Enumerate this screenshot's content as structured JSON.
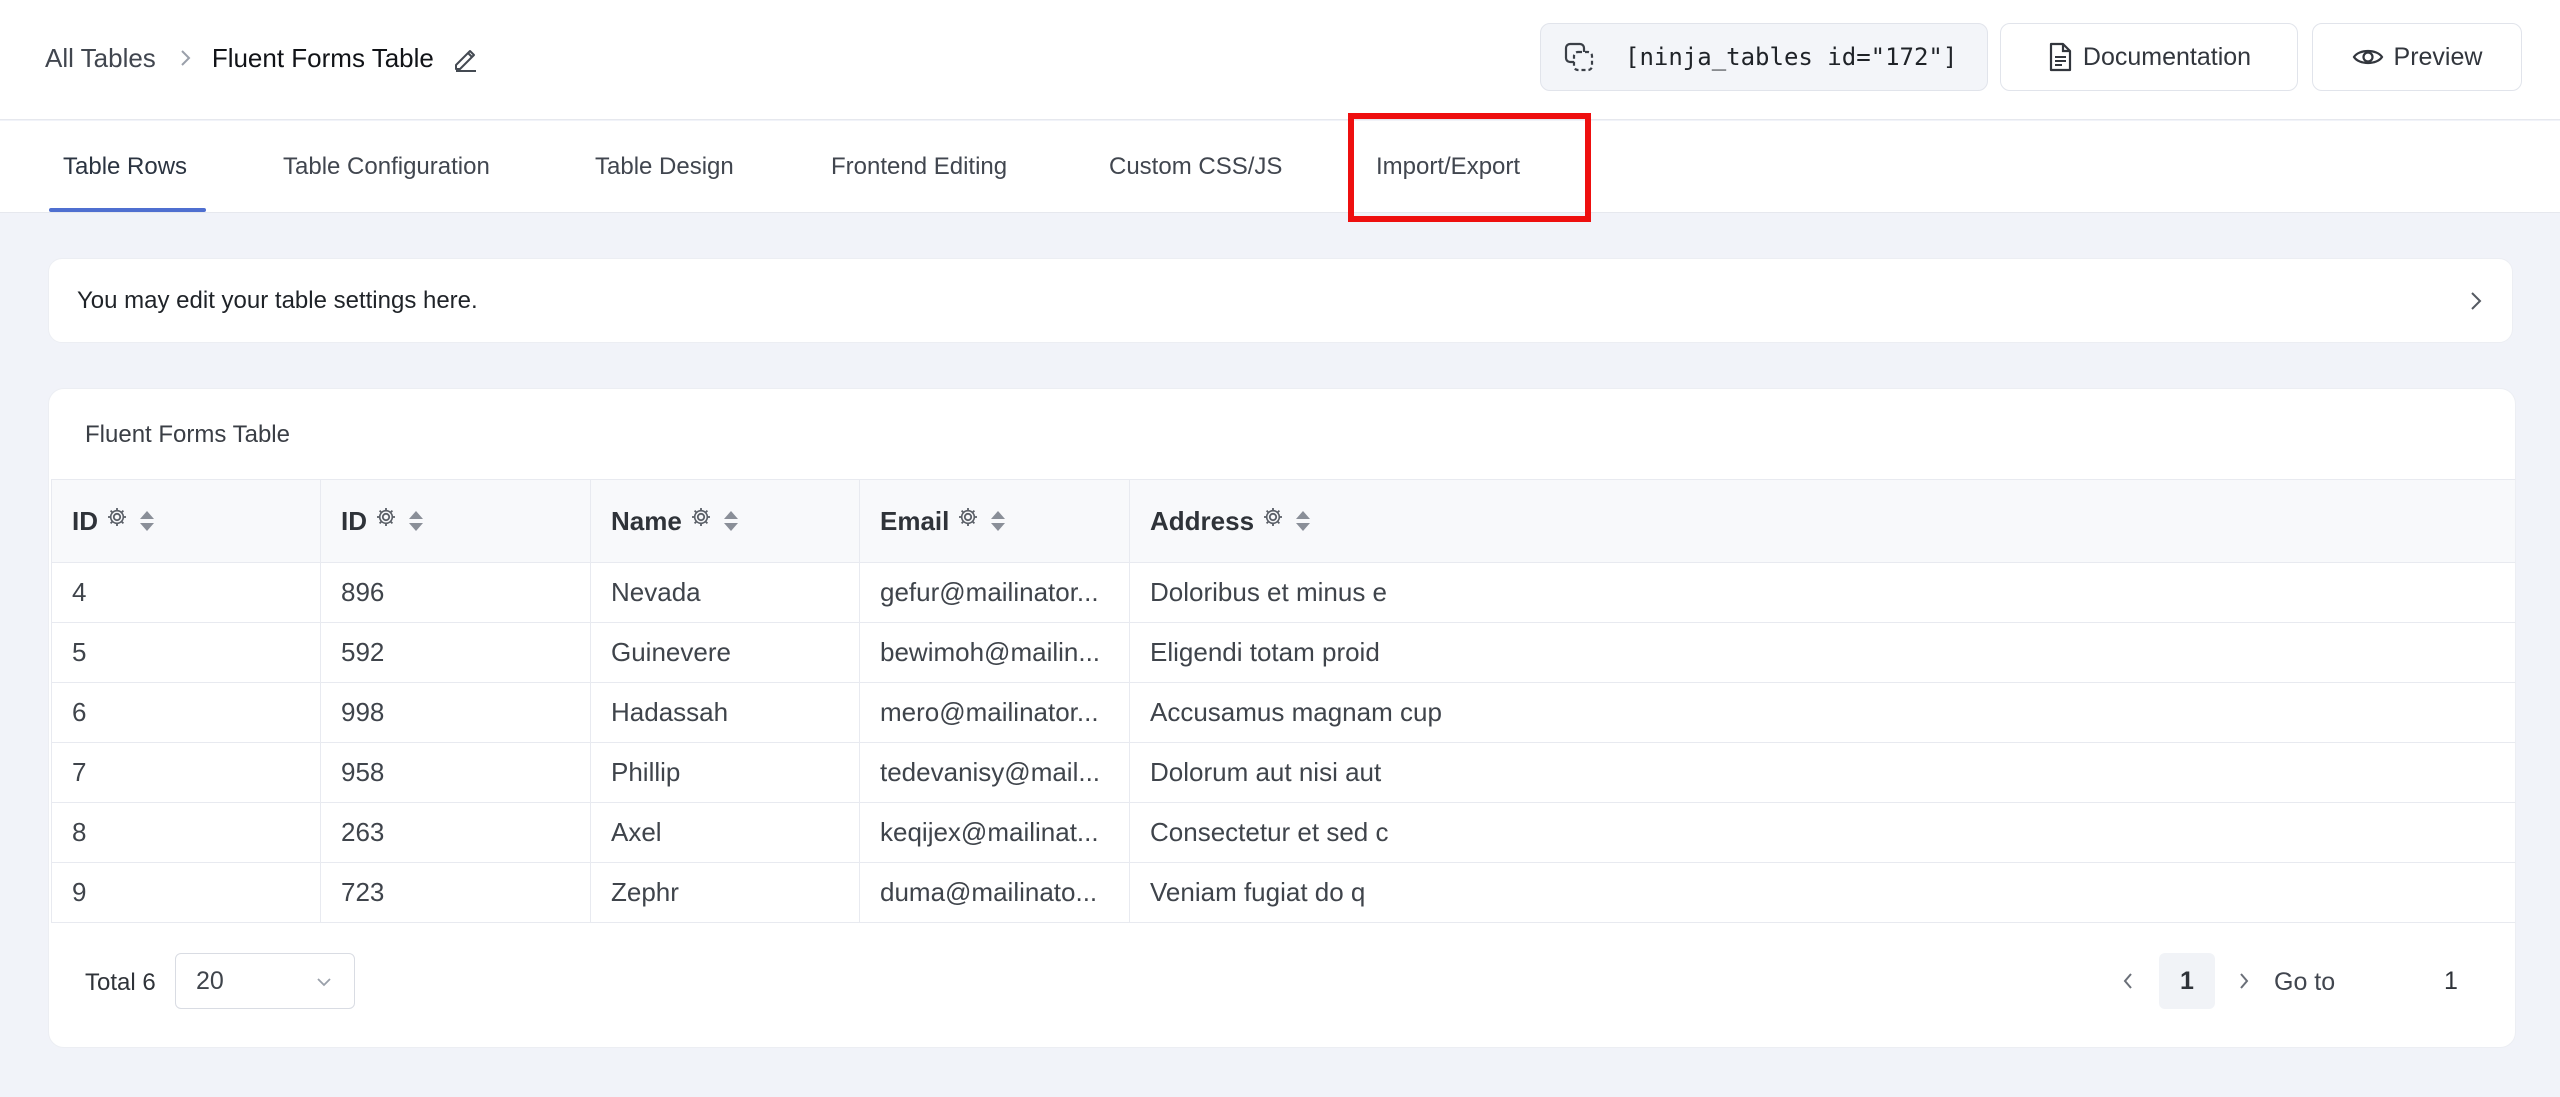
{
  "breadcrumb": {
    "root": "All Tables",
    "current": "Fluent Forms Table"
  },
  "header": {
    "shortcode": "[ninja_tables id=\"172\"]",
    "documentation_label": "Documentation",
    "preview_label": "Preview"
  },
  "tabs": [
    {
      "label": "Table Rows",
      "active": true
    },
    {
      "label": "Table Configuration",
      "active": false
    },
    {
      "label": "Table Design",
      "active": false
    },
    {
      "label": "Frontend Editing",
      "active": false
    },
    {
      "label": "Custom CSS/JS",
      "active": false
    },
    {
      "label": "Import/Export",
      "active": false,
      "highlighted": true
    }
  ],
  "info": {
    "text": "You may edit your table settings here."
  },
  "table": {
    "title": "Fluent Forms Table",
    "columns": [
      "ID",
      "ID",
      "Name",
      "Email",
      "Address"
    ],
    "rows": [
      [
        "4",
        "896",
        "Nevada",
        "gefur@mailinator...",
        "Doloribus et minus e"
      ],
      [
        "5",
        "592",
        "Guinevere",
        "bewimoh@mailin...",
        "Eligendi totam proid"
      ],
      [
        "6",
        "998",
        "Hadassah",
        "mero@mailinator...",
        "Accusamus magnam cup"
      ],
      [
        "7",
        "958",
        "Phillip",
        "tedevanisy@mail...",
        "Dolorum aut nisi aut"
      ],
      [
        "8",
        "263",
        "Axel",
        "keqijex@mailinat...",
        "Consectetur et sed c"
      ],
      [
        "9",
        "723",
        "Zephr",
        "duma@mailinato...",
        "Veniam fugiat do q"
      ]
    ]
  },
  "pagination": {
    "total_label": "Total 6",
    "page_size": "20",
    "current_page": "1",
    "goto_label": "Go to",
    "goto_value": "1"
  },
  "colors": {
    "accent": "#4f6fd0",
    "highlight": "#ee0f0f",
    "background": "#f1f3f9"
  }
}
